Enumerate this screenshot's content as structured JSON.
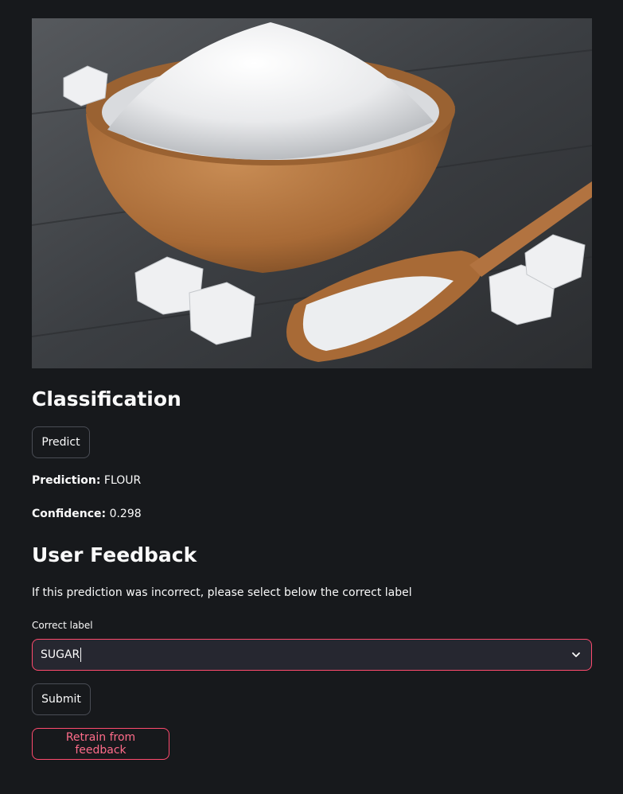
{
  "classification": {
    "heading": "Classification",
    "predict_label": "Predict",
    "prediction_key": "Prediction:",
    "prediction_value": "FLOUR",
    "confidence_key": "Confidence:",
    "confidence_value": "0.298"
  },
  "feedback": {
    "heading": "User Feedback",
    "instruction": "If this prediction was incorrect, please select below the correct label",
    "field_label": "Correct label",
    "selected_value": "SUGAR",
    "submit_label": "Submit",
    "retrain_label": "Retrain from feedback"
  },
  "icons": {
    "dropdown": "chevron-down-icon"
  },
  "colors": {
    "background": "#17191c",
    "accent": "#ff4b6e",
    "input_background": "#262730"
  }
}
